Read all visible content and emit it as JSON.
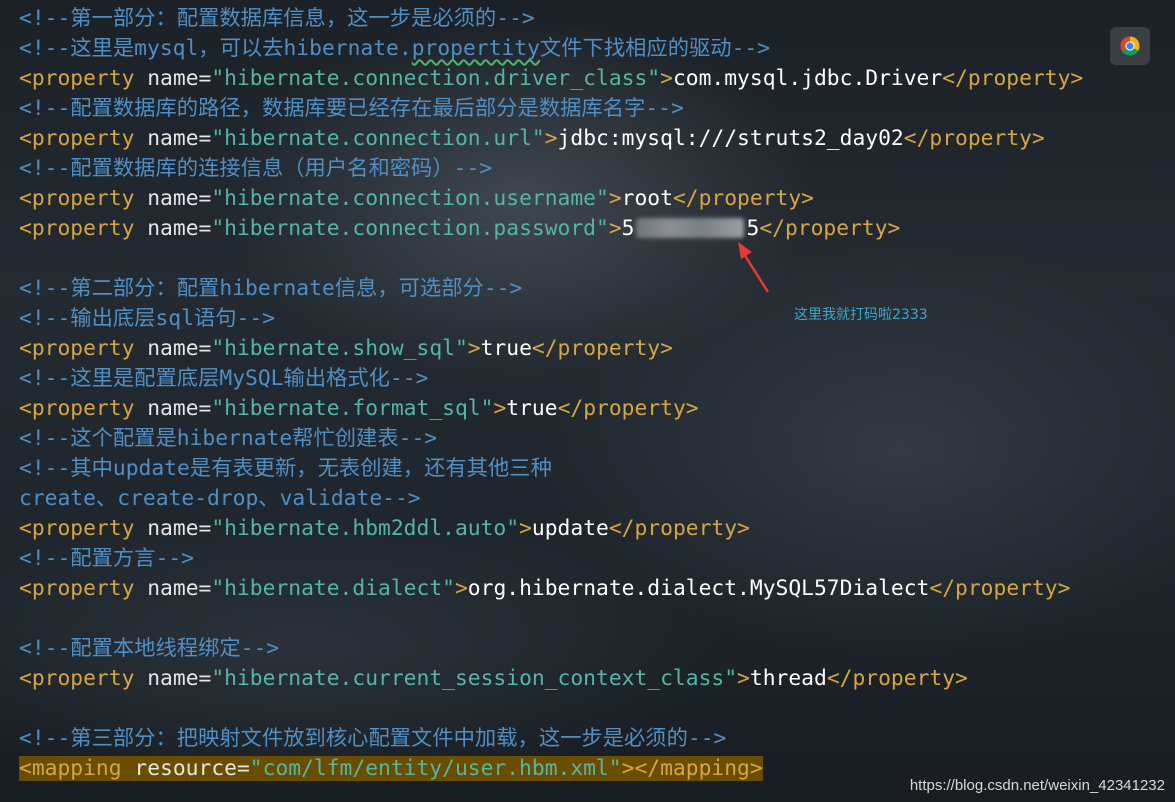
{
  "code_lines": [
    {
      "comment": "<!--第一部分：配置数据库信息，这一步是必须的-->"
    },
    {
      "comment_pre": "<!--这里是mysql，可以去hibernate.",
      "comment_underlined": "propertity",
      "comment_post": "文件下找相应的驱动-->"
    },
    {
      "tag_open": "<property",
      "attr": " name=",
      "value": "\"hibernate.connection.driver_class\"",
      "tag_gt": ">",
      "text": "com.mysql.jdbc.Driver",
      "tag_close": "</property>"
    },
    {
      "comment": "<!--配置数据库的路径，数据库要已经存在最后部分是数据库名字-->"
    },
    {
      "tag_open": "<property",
      "attr": " name=",
      "value": "\"hibernate.connection.url\"",
      "tag_gt": ">",
      "text": "jdbc:mysql:///struts2_day02",
      "tag_close": "</property>"
    },
    {
      "comment": "<!--配置数据库的连接信息（用户名和密码）-->"
    },
    {
      "tag_open": "<property",
      "attr": " name=",
      "value": "\"hibernate.connection.username\"",
      "tag_gt": ">",
      "text": "root",
      "tag_close": "</property>"
    },
    {
      "tag_open": "<property",
      "attr": " name=",
      "value": "\"hibernate.connection.password\"",
      "tag_gt": ">",
      "text_start": "5",
      "text_end": "5",
      "tag_close": "</property>"
    },
    {
      "comment": "<!--第二部分：配置hibernate信息，可选部分-->"
    },
    {
      "comment": "<!--输出底层sql语句-->"
    },
    {
      "tag_open": "<property",
      "attr": " name=",
      "value": "\"hibernate.show_sql\"",
      "tag_gt": ">",
      "text": "true",
      "tag_close": "</property>"
    },
    {
      "comment": "<!--这里是配置底层MySQL输出格式化-->"
    },
    {
      "tag_open": "<property",
      "attr": " name=",
      "value": "\"hibernate.format_sql\"",
      "tag_gt": ">",
      "text": "true",
      "tag_close": "</property>"
    },
    {
      "comment": "<!--这个配置是hibernate帮忙创建表-->"
    },
    {
      "comment": "<!--其中update是有表更新，无表创建，还有其他三种"
    },
    {
      "comment": "create、create-drop、validate-->"
    },
    {
      "tag_open": "<property",
      "attr": " name=",
      "value": "\"hibernate.hbm2ddl.auto\"",
      "tag_gt": ">",
      "text": "update",
      "tag_close": "</property>"
    },
    {
      "comment": "<!--配置方言-->"
    },
    {
      "tag_open": "<property",
      "attr": " name=",
      "value": "\"hibernate.dialect\"",
      "tag_gt": ">",
      "text": "org.hibernate.dialect.MySQL57Dialect",
      "tag_close": "</property>"
    },
    {
      "comment": "<!--配置本地线程绑定-->"
    },
    {
      "tag_open": "<property",
      "attr": " name=",
      "value": "\"hibernate.current_session_context_class\"",
      "tag_gt": ">",
      "text": "thread",
      "tag_close": "</property>"
    },
    {
      "comment": "<!--第三部分：把映射文件放到核心配置文件中加载，这一步是必须的-->"
    },
    {
      "tag_open": "<mapping",
      "attr": " resource=",
      "value": "\"com/lfm/entity/user.hbm.xml\"",
      "tag_gt": ">",
      "tag_close": "</mapping>"
    }
  ],
  "annotation": "这里我就打码啦2333",
  "watermark": "https://blog.csdn.net/weixin_42341232",
  "colors": {
    "comment": "#4f8fc4",
    "tag": "#d8a640",
    "string": "#55b6a3",
    "text": "#ffffff",
    "highlight": "#6b4d00",
    "annotation": "#3fa6c8",
    "arrow": "#e53935"
  },
  "icons": {
    "browser_button": "chrome-icon",
    "pointer": "red-arrow-icon"
  }
}
